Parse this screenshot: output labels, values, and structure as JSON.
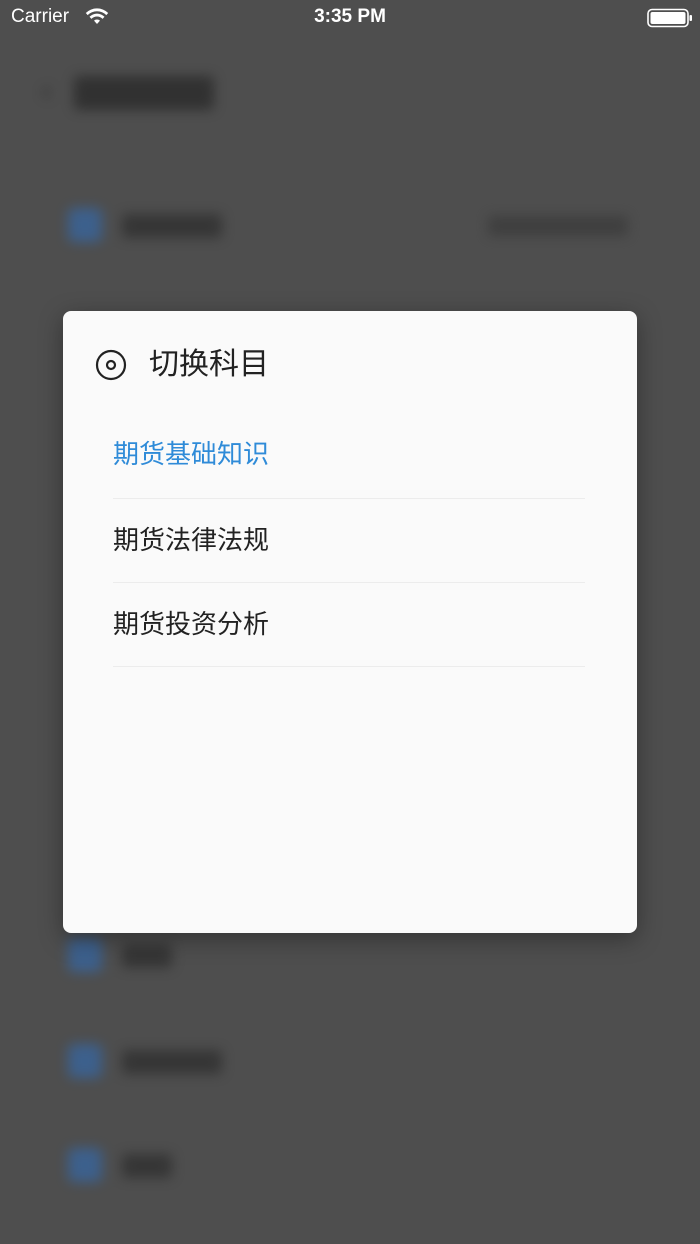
{
  "status_bar": {
    "carrier": "Carrier",
    "time": "3:35 PM"
  },
  "modal": {
    "title": "切换科目",
    "options": [
      {
        "label": "期货基础知识",
        "selected": true
      },
      {
        "label": "期货法律法规",
        "selected": false
      },
      {
        "label": "期货投资分析",
        "selected": false
      }
    ],
    "selected_color": "#2f8bd8"
  }
}
